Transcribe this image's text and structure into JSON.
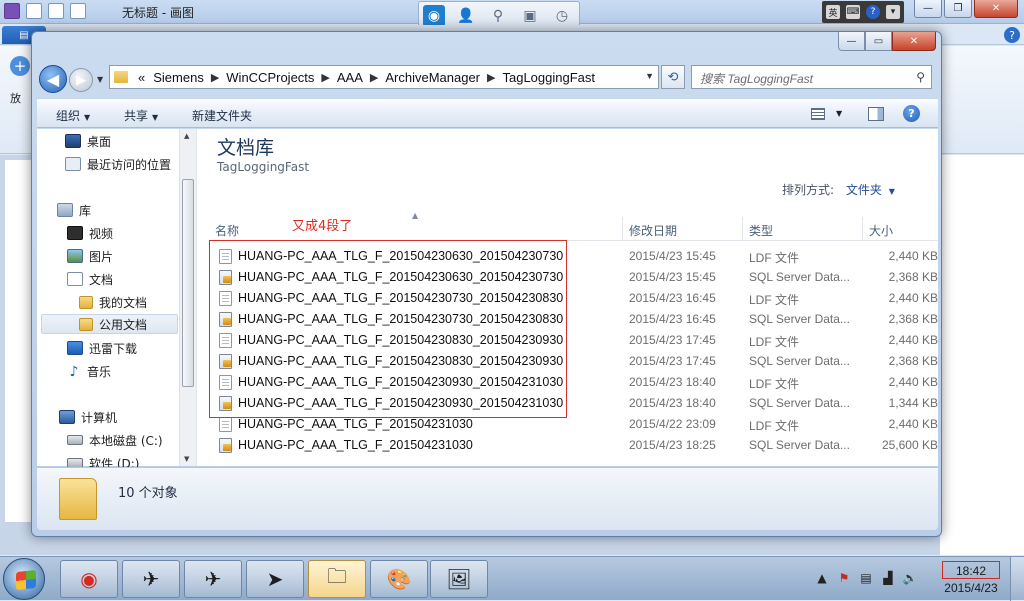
{
  "paint": {
    "window_title": "无标题 - 画图",
    "left_partial_label": "放"
  },
  "explorer": {
    "breadcrumb": {
      "overflow": "«",
      "segments": [
        "Siemens",
        "WinCCProjects",
        "AAA",
        "ArchiveManager",
        "TagLoggingFast"
      ]
    },
    "search_placeholder": "搜索 TagLoggingFast",
    "toolbar": {
      "organize": "组织",
      "share": "共享",
      "new_folder": "新建文件夹"
    },
    "nav": {
      "desktop": "桌面",
      "recent": "最近访问的位置",
      "libraries": "库",
      "videos": "视频",
      "pictures": "图片",
      "documents": "文档",
      "my_documents": "我的文档",
      "public_documents": "公用文档",
      "thunder": "迅雷下载",
      "music": "音乐",
      "computer": "计算机",
      "local_disk_c": "本地磁盘 (C:)",
      "software_d": "软件 (D:)"
    },
    "library": {
      "title": "文档库",
      "subtitle": "TagLoggingFast",
      "arrange_label": "排列方式:",
      "arrange_value": "文件夹"
    },
    "columns": {
      "name": "名称",
      "date": "修改日期",
      "type": "类型",
      "size": "大小"
    },
    "annotation": "又成4段了",
    "files": [
      {
        "name": "HUANG-PC_AAA_TLG_F_201504230630_201504230730",
        "date": "2015/4/23 15:45",
        "type": "LDF 文件",
        "size": "2,440 KB",
        "icon": "ldf-file-icon"
      },
      {
        "name": "HUANG-PC_AAA_TLG_F_201504230630_201504230730",
        "date": "2015/4/23 15:45",
        "type": "SQL Server Data...",
        "size": "2,368 KB",
        "icon": "sql-file-icon"
      },
      {
        "name": "HUANG-PC_AAA_TLG_F_201504230730_201504230830",
        "date": "2015/4/23 16:45",
        "type": "LDF 文件",
        "size": "2,440 KB",
        "icon": "ldf-file-icon"
      },
      {
        "name": "HUANG-PC_AAA_TLG_F_201504230730_201504230830",
        "date": "2015/4/23 16:45",
        "type": "SQL Server Data...",
        "size": "2,368 KB",
        "icon": "sql-file-icon"
      },
      {
        "name": "HUANG-PC_AAA_TLG_F_201504230830_201504230930",
        "date": "2015/4/23 17:45",
        "type": "LDF 文件",
        "size": "2,440 KB",
        "icon": "ldf-file-icon"
      },
      {
        "name": "HUANG-PC_AAA_TLG_F_201504230830_201504230930",
        "date": "2015/4/23 17:45",
        "type": "SQL Server Data...",
        "size": "2,368 KB",
        "icon": "sql-file-icon"
      },
      {
        "name": "HUANG-PC_AAA_TLG_F_201504230930_201504231030",
        "date": "2015/4/23 18:40",
        "type": "LDF 文件",
        "size": "2,440 KB",
        "icon": "ldf-file-icon"
      },
      {
        "name": "HUANG-PC_AAA_TLG_F_201504230930_201504231030",
        "date": "2015/4/23 18:40",
        "type": "SQL Server Data...",
        "size": "1,344 KB",
        "icon": "sql-file-icon"
      },
      {
        "name": "HUANG-PC_AAA_TLG_F_201504231030",
        "date": "2015/4/22 23:09",
        "type": "LDF 文件",
        "size": "2,440 KB",
        "icon": "ldf-file-icon"
      },
      {
        "name": "HUANG-PC_AAA_TLG_F_201504231030",
        "date": "2015/4/23 18:25",
        "type": "SQL Server Data...",
        "size": "25,600 KB",
        "icon": "sql-file-icon"
      }
    ],
    "status": {
      "item_count": "10 个对象"
    }
  },
  "taskbar": {
    "clock_time": "18:42",
    "clock_date": "2015/4/23"
  },
  "colors": {
    "annotation_red": "#e0281f",
    "link_blue": "#1f4d96",
    "title_blue": "#1e395b"
  }
}
